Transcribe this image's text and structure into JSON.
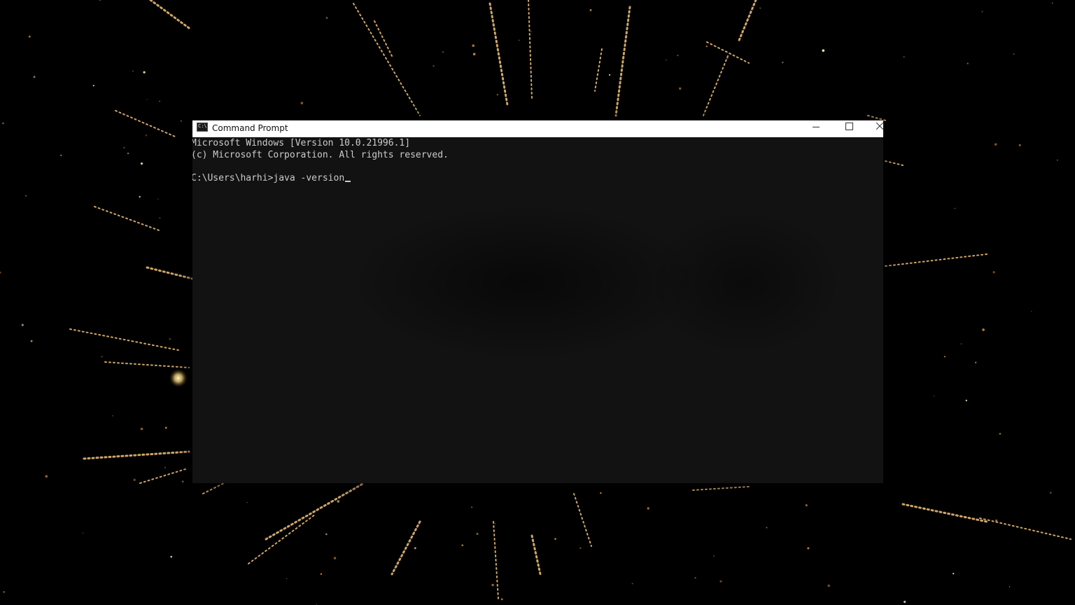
{
  "window": {
    "title": "Command Prompt",
    "icon": "cmd-app-icon",
    "icon_glyph": "C:\\",
    "controls": {
      "minimize": "minimize-icon",
      "maximize": "maximize-icon",
      "close": "close-icon"
    }
  },
  "console": {
    "lines": [
      "Microsoft Windows [Version 10.0.21996.1]",
      "(c) Microsoft Corporation. All rights reserved.",
      "",
      "C:\\Users\\harhi>java -version"
    ],
    "text_color": "#cccccc",
    "background_color": "#0c0c0c"
  },
  "wallpaper": {
    "description_icon": "fireworks-wallpaper",
    "accent_color": "#f2c27a"
  }
}
